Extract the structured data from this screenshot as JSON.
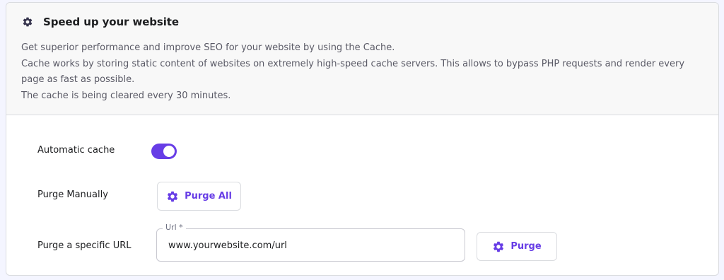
{
  "header": {
    "icon": "gear-icon",
    "title": "Speed up your website",
    "description": [
      "Get superior performance and improve SEO for your website by using the Cache.",
      "Cache works by storing static content of websites on extremely high-speed cache servers. This allows to bypass PHP requests and render every page as fast as possible.",
      "The cache is being cleared every 30 minutes."
    ]
  },
  "automatic_cache": {
    "label": "Automatic cache",
    "enabled": true
  },
  "purge_manually": {
    "label": "Purge Manually",
    "button_label": "Purge All",
    "button_icon": "gear-icon"
  },
  "purge_url": {
    "label": "Purge a specific URL",
    "field_label": "Url *",
    "value": "www.yourwebsite.com/url",
    "button_label": "Purge",
    "button_icon": "gear-icon"
  },
  "colors": {
    "accent": "#673de6",
    "text": "#1d1e20",
    "muted": "#5a5a66",
    "border": "#dadce0"
  }
}
